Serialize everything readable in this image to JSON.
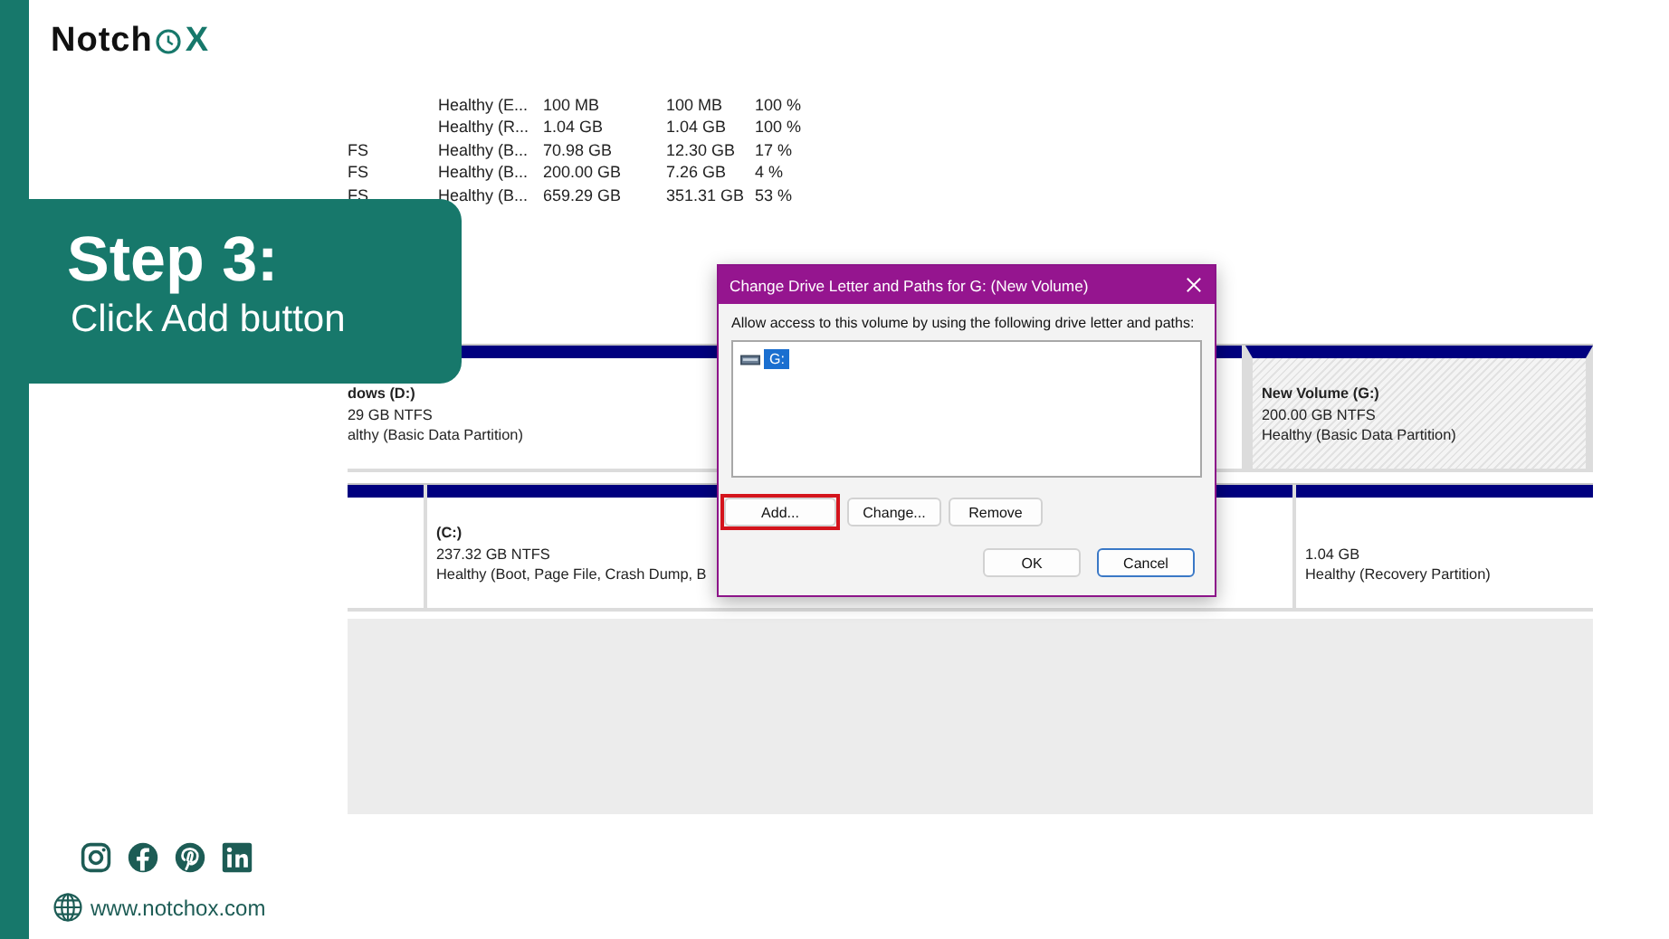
{
  "brand": {
    "lead": "Notch",
    "tail": "X"
  },
  "step": {
    "title": "Step 3:",
    "subtitle": "Click Add button"
  },
  "volume_table": {
    "rows": [
      {
        "status": "Healthy (E...",
        "capacity": "100 MB",
        "free_space": "100 MB",
        "percent_free": "100 %"
      },
      {
        "status": "Healthy (R...",
        "capacity": "1.04 GB",
        "free_space": "1.04 GB",
        "percent_free": "100 %"
      },
      {
        "file_system": "FS",
        "status": "Healthy (B...",
        "capacity": "70.98 GB",
        "free_space": "12.30 GB",
        "percent_free": "17 %"
      },
      {
        "file_system": "FS",
        "status": "Healthy (B...",
        "capacity": "200.00 GB",
        "free_space": "7.26 GB",
        "percent_free": "4 %"
      },
      {
        "file_system": "FS",
        "status": "Healthy (B...",
        "capacity": "659.29 GB",
        "free_space": "351.31 GB",
        "percent_free": "53 %"
      }
    ]
  },
  "disks": [
    {
      "partitions": [
        {
          "name": "dows  (D:)",
          "size": "29 GB NTFS",
          "status": "althy (Basic Data Partition)",
          "selected": false
        },
        {
          "name": "New Volume  (G:)",
          "size": "200.00 GB NTFS",
          "status": "Healthy (Basic Data Partition)",
          "selected": true
        }
      ]
    },
    {
      "partitions": [
        {
          "selected": false
        },
        {
          "name": "(C:)",
          "size": "237.32 GB NTFS",
          "status": "Healthy (Boot, Page File, Crash Dump, B",
          "selected": false
        },
        {
          "size": "1.04 GB",
          "status": "Healthy (Recovery Partition)",
          "selected": false
        }
      ]
    }
  ],
  "dialog": {
    "title": "Change Drive Letter and Paths for G: (New Volume)",
    "prompt": "Allow access to this volume by using the following drive letter and paths:",
    "paths": [
      {
        "label": "G:",
        "selected": true
      }
    ],
    "buttons": [
      {
        "label": "Add...",
        "highlighted": true
      },
      {
        "label": "Change...",
        "highlighted": false
      },
      {
        "label": "Remove",
        "highlighted": false
      }
    ],
    "footer_buttons": [
      {
        "label": "OK",
        "focused": false
      },
      {
        "label": "Cancel",
        "focused": true
      }
    ]
  },
  "footer": {
    "website": "www.notchox.com"
  }
}
